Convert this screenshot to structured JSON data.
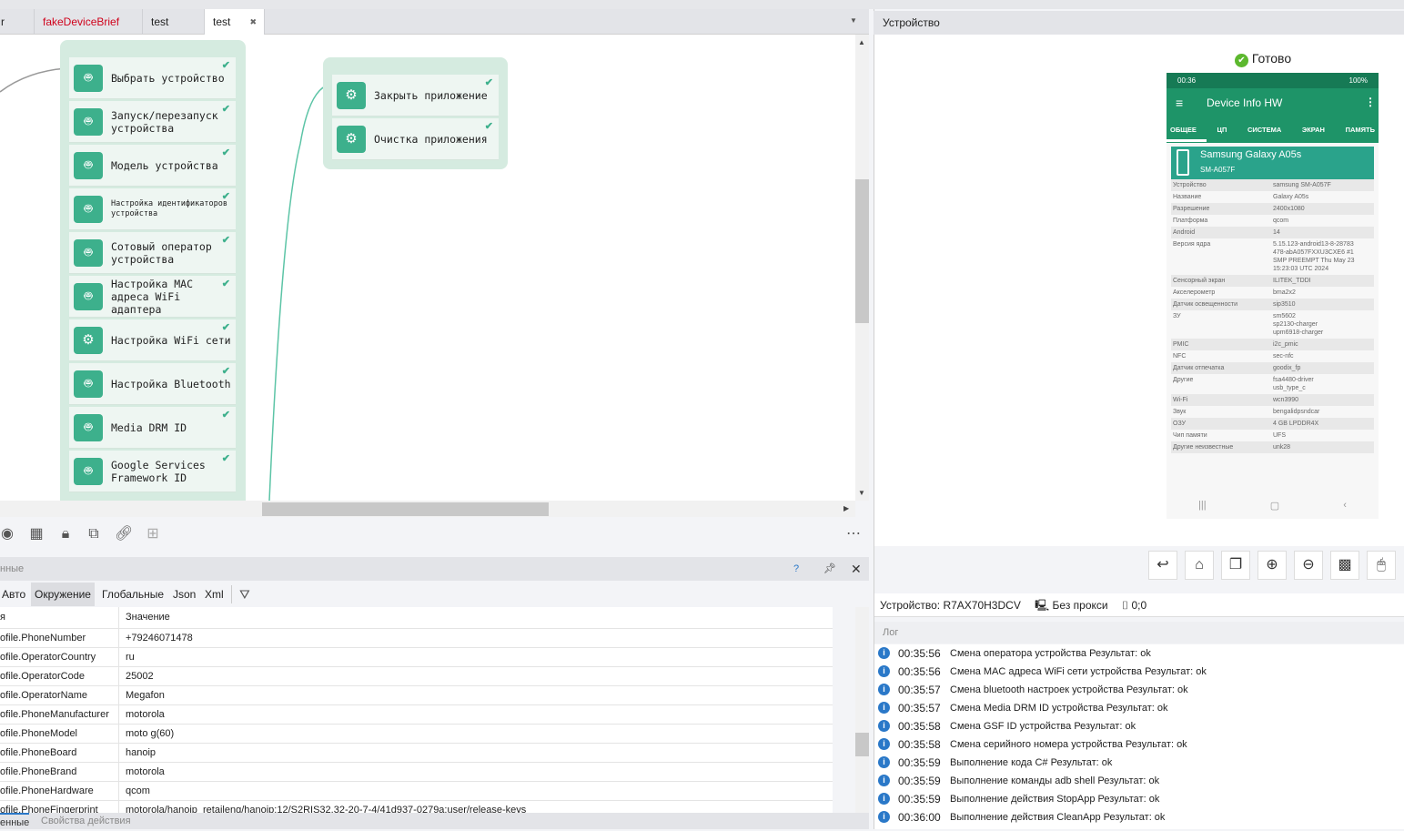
{
  "tabs": [
    {
      "label": "r",
      "color": "#222"
    },
    {
      "label": "fakeDeviceBrief",
      "color": "#d0021b"
    },
    {
      "label": "test",
      "color": "#222"
    },
    {
      "label": "test",
      "color": "#222",
      "active": true
    }
  ],
  "group1": [
    {
      "label": "Выбрать устройство",
      "icon": "android"
    },
    {
      "label": "Запуск/перезапуск устройства",
      "icon": "android"
    },
    {
      "label": "Модель устройства",
      "icon": "android"
    },
    {
      "label": "Настройка идентификаторов устройства",
      "icon": "android",
      "small": true
    },
    {
      "label": "Сотовый оператор устройства",
      "icon": "android"
    },
    {
      "label": "Настройка MAC адреса WiFi адаптера",
      "icon": "android"
    },
    {
      "label": "Настройка WiFi сети",
      "icon": "gear"
    },
    {
      "label": "Настройка Bluetooth",
      "icon": "android"
    },
    {
      "label": "Media DRM ID",
      "icon": "android"
    },
    {
      "label": "Google Services Framework ID",
      "icon": "android"
    }
  ],
  "group2": [
    {
      "label": "Закрыть приложение",
      "icon": "gear"
    },
    {
      "label": "Очистка приложения",
      "icon": "gear"
    }
  ],
  "variables": {
    "title": "нные",
    "tabs": [
      "Авто",
      "Окружение",
      "Глобальные",
      "Json",
      "Xml"
    ],
    "active_tab": 1,
    "col_name": "я",
    "col_value": "Значение",
    "rows": [
      [
        "ofile.PhoneNumber",
        "+79246071478"
      ],
      [
        "ofile.OperatorCountry",
        "ru"
      ],
      [
        "ofile.OperatorCode",
        "25002"
      ],
      [
        "ofile.OperatorName",
        "Megafon"
      ],
      [
        "ofile.PhoneManufacturer",
        "motorola"
      ],
      [
        "ofile.PhoneModel",
        "moto g(60)"
      ],
      [
        "ofile.PhoneBoard",
        "hanoip"
      ],
      [
        "ofile.PhoneBrand",
        "motorola"
      ],
      [
        "ofile.PhoneHardware",
        "qcom"
      ],
      [
        "ofile.PhoneFingerprint",
        "motorola/hanoip_retaileng/hanoip:12/S2RIS32.32-20-7-4/41d937-0279a:user/release-keys"
      ]
    ],
    "bottom_tabs": [
      "енные",
      "Свойства действия"
    ]
  },
  "device": {
    "header": "Устройство",
    "ready": "Готово",
    "phone": {
      "time": "00:36",
      "battery": "100%",
      "app_title": "Device Info HW",
      "tabs": [
        "ОБЩЕЕ",
        "ЦП",
        "СИСТЕМА",
        "ЭКРАН",
        "ПАМЯТЬ"
      ],
      "model_name": "Samsung Galaxy A05s",
      "model_code": "SM-A057F",
      "props": [
        [
          "Устройство",
          "samsung SM-A057F"
        ],
        [
          "Название",
          "Galaxy A05s"
        ],
        [
          "Разрешение",
          "2400x1080"
        ],
        [
          "Платформа",
          "qcom"
        ],
        [
          "Android",
          "14"
        ],
        [
          "Версия ядра",
          "5.15.123-android13-8-28783\n478-abA057FXXU3CXE6 #1\nSMP PREEMPT Thu May 23\n15:23:03 UTC 2024"
        ],
        [
          "Сенсорный экран",
          "ILITEK_TDDI"
        ],
        [
          "Акселерометр",
          "bma2x2"
        ],
        [
          "Датчик освещенности",
          "sip3510"
        ],
        [
          "ЗУ",
          "sm5602\nsp2130-charger\nupm6918-charger"
        ],
        [
          "PMIC",
          "i2c_pmic"
        ],
        [
          "NFC",
          "sec-nfc"
        ],
        [
          "Датчик отпечатка",
          "goodix_fp"
        ],
        [
          "Другие",
          "fsa4480-driver\nusb_type_c"
        ],
        [
          "Wi-Fi",
          "wcn3990"
        ],
        [
          "Звук",
          "bengalidpsndcar"
        ],
        [
          "ОЗУ",
          "4 GB LPDDR4X"
        ],
        [
          "Чип памяти",
          "UFS"
        ],
        [
          "Другие неизвестные",
          "unk28"
        ]
      ]
    },
    "status_device": "Устройство: R7AX70H3DCV",
    "status_proxy": "Без прокси",
    "status_coords": "0;0"
  },
  "log": {
    "title": "Лог",
    "rows": [
      [
        "00:35:56",
        "Смена оператора устройства Результат: ok"
      ],
      [
        "00:35:56",
        "Смена MAC адреса WiFi сети устройства Результат: ok"
      ],
      [
        "00:35:57",
        "Смена bluetooth настроек устройства  Результат: ok"
      ],
      [
        "00:35:57",
        "Смена Media DRM ID устройства  Результат: ok"
      ],
      [
        "00:35:58",
        "Смена GSF ID устройства  Результат: ok"
      ],
      [
        "00:35:58",
        "Смена серийного номера устройства Результат: ok"
      ],
      [
        "00:35:59",
        "Выполнение кода C# Результат: ok"
      ],
      [
        "00:35:59",
        "Выполнение команды adb shell Результат: ok"
      ],
      [
        "00:35:59",
        "Выполнение действия StopApp Результат: ok"
      ],
      [
        "00:36:00",
        "Выполнение действия CleanApp Результат: ok"
      ]
    ]
  },
  "colors": {
    "accent": "#3db08c",
    "group_bg": "#d5ebe0",
    "phone_bar": "#1e9468",
    "info": "#2a78c8"
  }
}
